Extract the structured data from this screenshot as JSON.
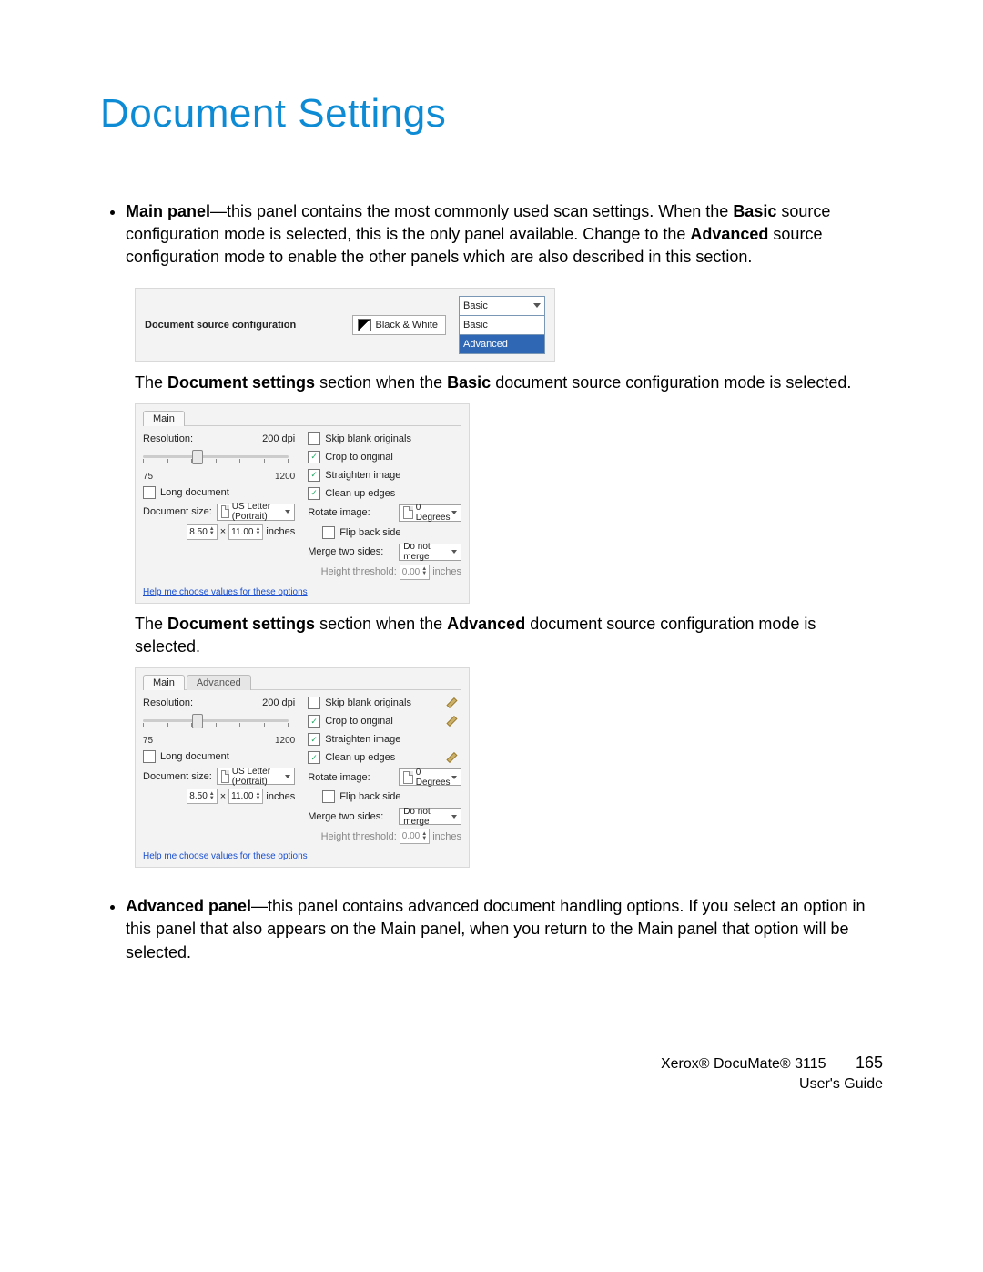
{
  "title": "Document Settings",
  "bullet1": {
    "lead": "Main panel",
    "text": "—this panel contains the most commonly used scan settings. When the ",
    "bold2": "Basic",
    "text2": " source configuration mode is selected, this is the only panel available. Change to the ",
    "bold3": "Advanced",
    "text3": " source configuration mode to enable the other panels which are also described in this section."
  },
  "fig1": {
    "label": "Document source configuration",
    "bw": "Black & White",
    "dd_selected": "Basic",
    "dd_opt1": "Basic",
    "dd_opt2": "Advanced"
  },
  "caption1": {
    "pre": "The ",
    "bold": "Document settings",
    "mid": " section when the ",
    "bold2": "Basic",
    "post": " document source configuration mode is selected."
  },
  "panel": {
    "tab_main": "Main",
    "tab_advanced": "Advanced",
    "resolution_label": "Resolution:",
    "resolution_value": "200 dpi",
    "slider_min": "75",
    "slider_max": "1200",
    "long_document": "Long document",
    "document_size_label": "Document size:",
    "document_size_value": "US Letter (Portrait)",
    "width": "8.50",
    "times": "×",
    "height": "11.00",
    "units": "inches",
    "skip_blank": "Skip blank originals",
    "crop": "Crop to original",
    "straighten": "Straighten image",
    "clean": "Clean up edges",
    "rotate_label": "Rotate image:",
    "rotate_value": "0 Degrees",
    "flip": "Flip back side",
    "merge_label": "Merge two sides:",
    "merge_value": "Do not merge",
    "height_threshold_label": "Height threshold:",
    "height_threshold_value": "0.00",
    "height_threshold_units": "inches",
    "help_link": "Help me choose values for these options"
  },
  "caption2": {
    "pre": "The ",
    "bold": "Document settings",
    "mid": " section when the ",
    "bold2": "Advanced",
    "post": " document source configuration mode is selected."
  },
  "bullet2": {
    "lead": "Advanced panel",
    "text": "—this panel contains advanced document handling options. If you select an option in this panel that also appears on the Main panel, when you return to the Main panel that option will be selected."
  },
  "footer": {
    "product": "Xerox® DocuMate® 3115",
    "guide": "User's Guide",
    "page": "165"
  }
}
